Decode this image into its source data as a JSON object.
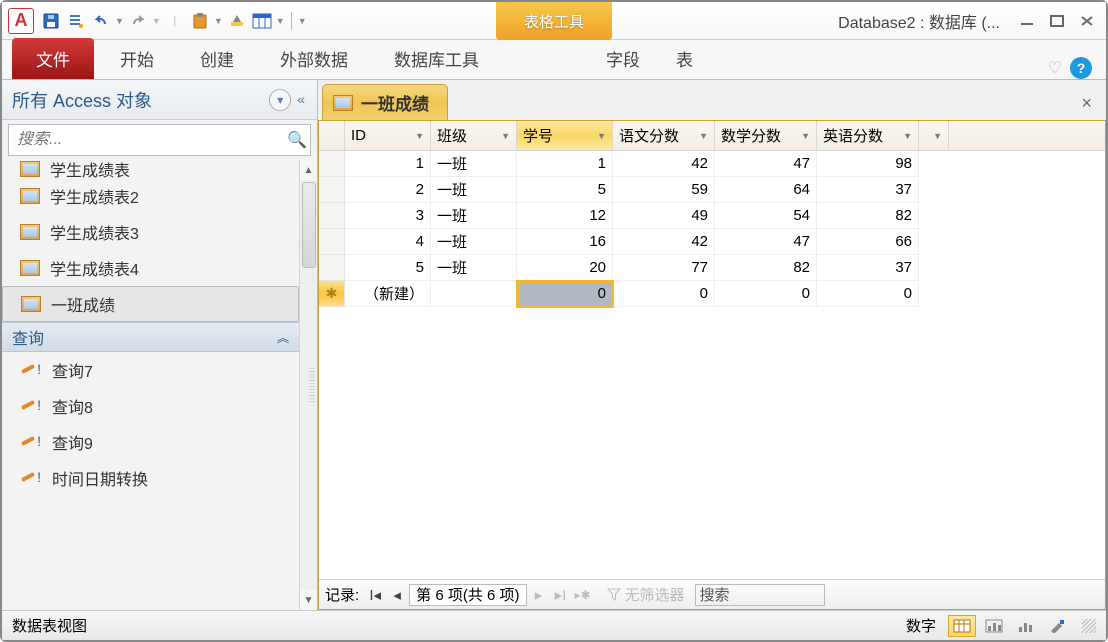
{
  "app": {
    "logo_letter": "A",
    "title": "Database2 : 数据库 (..."
  },
  "qat": [
    "save",
    "customize",
    "undo",
    "undo-dd",
    "redo",
    "unknown1",
    "paste",
    "unknown2",
    "view",
    "view-dd",
    "sep"
  ],
  "context_tab": "表格工具",
  "ribbon": {
    "file": "文件",
    "tabs": [
      "开始",
      "创建",
      "外部数据",
      "数据库工具"
    ],
    "ctx_tabs": [
      "字段",
      "表"
    ]
  },
  "nav": {
    "title": "所有 Access 对象",
    "search_placeholder": "搜索...",
    "partial_top": "学生成绩表",
    "tables": [
      "学生成绩表2",
      "学生成绩表3",
      "学生成绩表4",
      "一班成绩"
    ],
    "selected_table_index": 3,
    "query_group": "查询",
    "queries": [
      "查询7",
      "查询8",
      "查询9",
      "时间日期转换"
    ]
  },
  "doc": {
    "tab_label": "一班成绩",
    "columns": [
      "ID",
      "班级",
      "学号",
      "语文分数",
      "数学分数",
      "英语分数"
    ],
    "selected_col_index": 2,
    "rows": [
      {
        "id": 1,
        "cls": "一班",
        "sid": 1,
        "c": 42,
        "m": 47,
        "e": 98
      },
      {
        "id": 2,
        "cls": "一班",
        "sid": 5,
        "c": 59,
        "m": 64,
        "e": 37
      },
      {
        "id": 3,
        "cls": "一班",
        "sid": 12,
        "c": 49,
        "m": 54,
        "e": 82
      },
      {
        "id": 4,
        "cls": "一班",
        "sid": 16,
        "c": 42,
        "m": 47,
        "e": 66
      },
      {
        "id": 5,
        "cls": "一班",
        "sid": 20,
        "c": 77,
        "m": 82,
        "e": 37
      }
    ],
    "new_row": {
      "label": "（新建）",
      "sid": 0,
      "c": 0,
      "m": 0,
      "e": 0
    },
    "recnav": {
      "label": "记录:",
      "pos": "第 6 项(共 6 项)",
      "filter": "无筛选器",
      "search": "搜索"
    }
  },
  "status": {
    "left": "数据表视图",
    "right": "数字"
  }
}
